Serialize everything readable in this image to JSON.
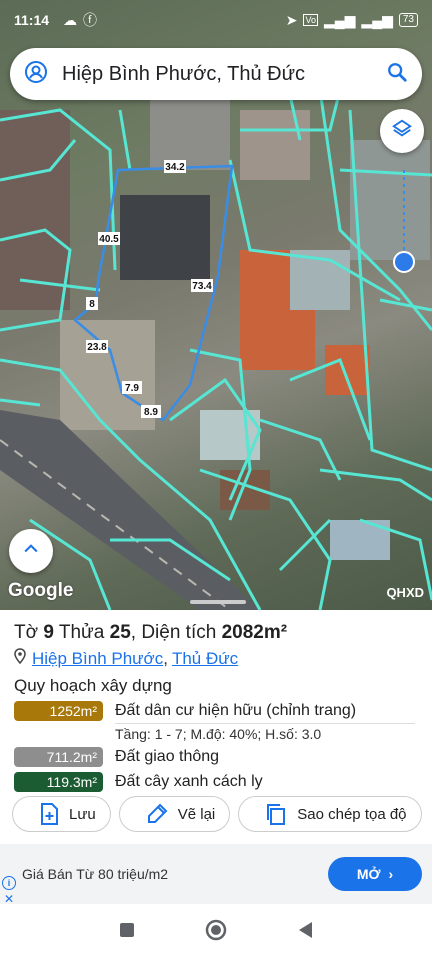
{
  "status_bar": {
    "time": "11:14",
    "battery": "73",
    "icons": [
      "notification-cloud-icon",
      "facebook-icon",
      "location-arrow-icon",
      "vowifi-icon",
      "4g-signal-icon",
      "signal-icon",
      "battery-icon"
    ]
  },
  "search": {
    "text": "Hiệp Bình Phước, Thủ Đức",
    "icons": [
      "account-icon",
      "search-icon"
    ]
  },
  "map": {
    "google_label": "Google",
    "layer_code": "QHXD",
    "segments": [
      "34.2",
      "40.5",
      "73.4",
      "8",
      "23.8",
      "7.9",
      "8.9"
    ],
    "colors": {
      "boundary": "#56e6d3",
      "parcel": "#3a8de6",
      "location_dot": "#2d7be8"
    }
  },
  "parcel": {
    "prefix_to": "Tờ ",
    "sheet": "9",
    "middle_thua": " Thửa ",
    "lot": "25",
    "middle_area": ", Diện tích ",
    "area": "2082m²",
    "ward": "Hiệp Bình Phước",
    "separator": ",",
    "district": "Thủ Đức"
  },
  "planning": {
    "title": "Quy hoạch xây dựng",
    "zones": [
      {
        "area": "1252m²",
        "name": "Đất dân cư hiện hữu (chỉnh trang)",
        "color": "#a8790a",
        "details": "Tầng: 1 - 7; M.độ: 40%; H.số: 3.0"
      },
      {
        "area": "711.2m²",
        "name": "Đất giao thông",
        "color": "#8e8e8e"
      },
      {
        "area": "119.3m²",
        "name": "Đất cây xanh cách ly",
        "color": "#1c5c32"
      }
    ]
  },
  "actions": {
    "save": "Lưu",
    "redraw": "Vẽ lại",
    "copy": "Sao chép tọa độ"
  },
  "ad": {
    "text": "Giá Bán Từ 80 triệu/m2",
    "cta": "MỞ",
    "info": "i",
    "close": "✕"
  }
}
